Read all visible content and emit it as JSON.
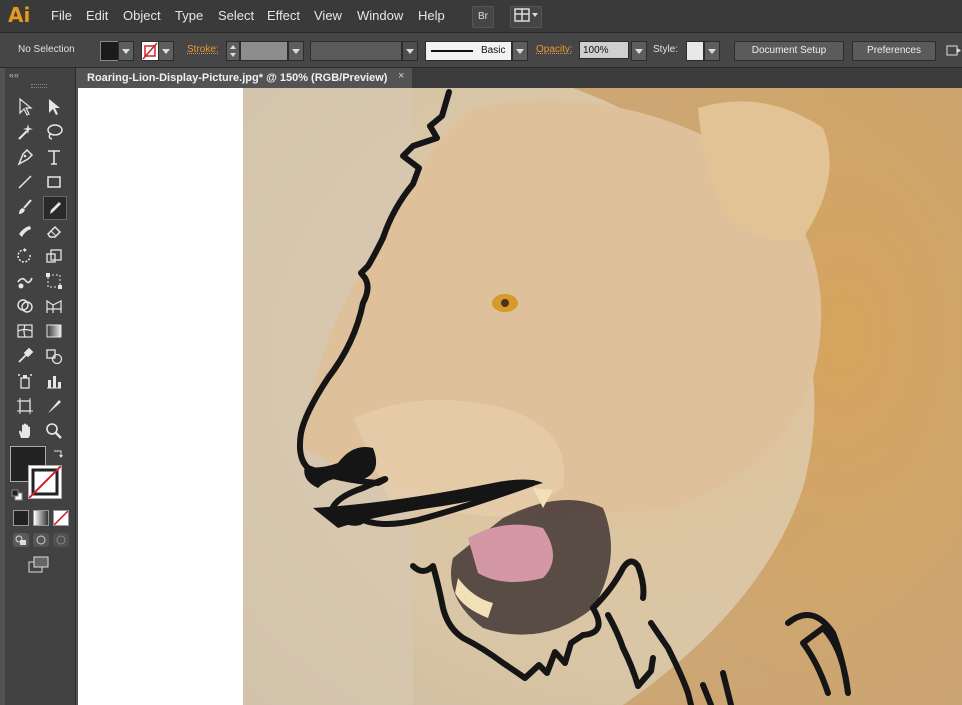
{
  "app": {
    "logo": "Ai"
  },
  "menu": [
    "File",
    "Edit",
    "Object",
    "Type",
    "Select",
    "Effect",
    "View",
    "Window",
    "Help"
  ],
  "menubar_buttons": {
    "bridge": "Br",
    "arrange": "arrange-documents-icon"
  },
  "control": {
    "selection": "No Selection",
    "stroke_label": "Stroke:",
    "brush_profile": "Basic",
    "opacity_label": "Opacity:",
    "opacity_value": "100%",
    "style_label": "Style:",
    "document_setup": "Document Setup",
    "preferences": "Preferences"
  },
  "document_tab": {
    "title": "Roaring-Lion-Display-Picture.jpg* @ 150% (RGB/Preview)",
    "close": "×"
  },
  "colors": {
    "accent": "#e69a1c",
    "ui_dark": "#3a3a3a",
    "canvas": "#ffffff"
  }
}
